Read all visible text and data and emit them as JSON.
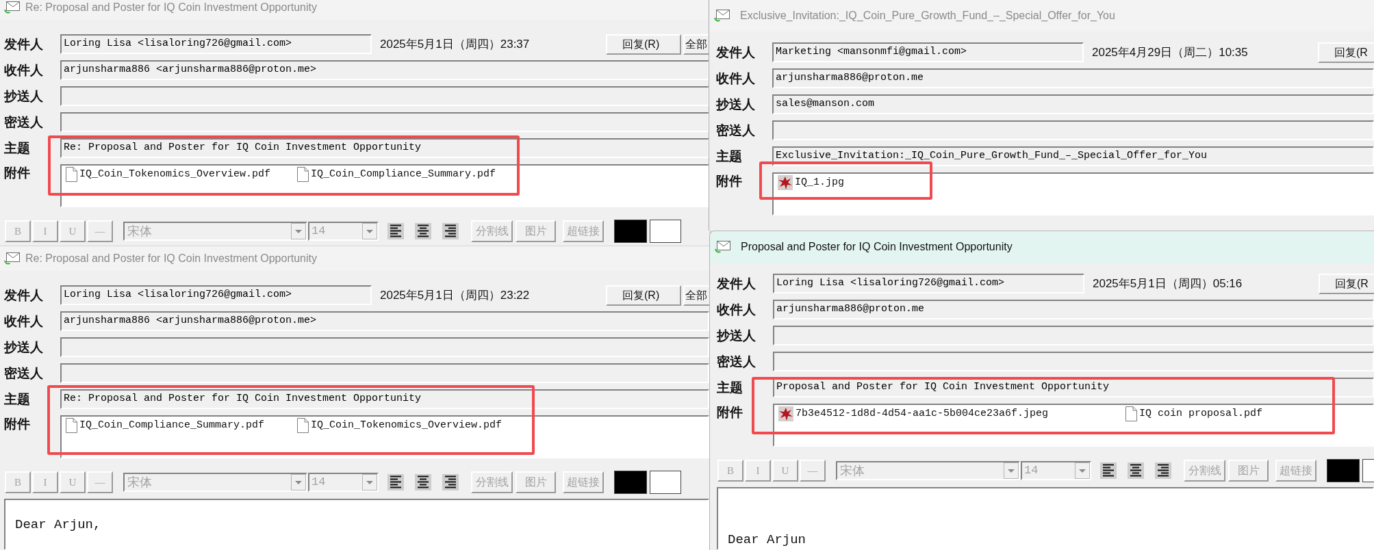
{
  "windows": [
    {
      "title": "Re: Proposal and Poster for IQ Coin Investment Opportunity",
      "active": false,
      "highlighted": true,
      "sender": {
        "label": "发件人",
        "value": "Loring Lisa <lisaloring726@gmail.com>"
      },
      "date": "2025年5月1日（周四）23:37",
      "buttons": [
        "回复(R)",
        "全部"
      ],
      "fields": [
        {
          "label": "收件人",
          "value": "arjunsharma886 <arjunsharma886@proton.me>"
        },
        {
          "label": "抄送人"
        },
        {
          "label": "密送人"
        },
        {
          "label": "主题",
          "value": "Re: Proposal and Poster for IQ Coin Investment Opportunity"
        }
      ],
      "attachments": {
        "label": "附件",
        "files": [
          {
            "kind": "document",
            "name": "IQ_Coin_Tokenomics_Overview.pdf"
          },
          {
            "kind": "document",
            "name": "IQ_Coin_Compliance_Summary.pdf"
          }
        ]
      },
      "toolbar": {
        "disabled": true,
        "format_buttons": [
          "B",
          "I",
          "U",
          "—"
        ],
        "font": "宋体",
        "size": "14",
        "buttons": [
          "分割线",
          "图片",
          "超链接"
        ],
        "swatches": [
          {
            "color": "#000000"
          },
          {
            "color": "#ffffff"
          }
        ]
      }
    },
    {
      "title": "Re: Proposal and Poster for IQ Coin Investment Opportunity",
      "active": false,
      "highlighted": true,
      "sender": {
        "label": "发件人",
        "value": "Loring Lisa <lisaloring726@gmail.com>"
      },
      "date": "2025年5月1日（周四）23:22",
      "buttons": [
        "回复(R)",
        "全部"
      ],
      "fields": [
        {
          "label": "收件人",
          "value": "arjunsharma886 <arjunsharma886@proton.me>"
        },
        {
          "label": "抄送人"
        },
        {
          "label": "密送人"
        },
        {
          "label": "主题",
          "value": "Re: Proposal and Poster for IQ Coin Investment Opportunity"
        }
      ],
      "attachments": {
        "label": "附件",
        "files": [
          {
            "kind": "document",
            "name": "IQ_Coin_Compliance_Summary.pdf"
          },
          {
            "kind": "document",
            "name": "IQ_Coin_Tokenomics_Overview.pdf"
          }
        ]
      },
      "toolbar": {
        "disabled": true,
        "format_buttons": [
          "B",
          "I",
          "U",
          "—"
        ],
        "font": "宋体",
        "size": "14",
        "buttons": [
          "分割线",
          "图片",
          "超链接"
        ],
        "swatches": [
          {
            "color": "#000000"
          },
          {
            "color": "#ffffff"
          }
        ]
      },
      "body": "Dear Arjun,"
    },
    {
      "title": "Exclusive_Invitation:_IQ_Coin_Pure_Growth_Fund_–_Special_Offer_for_You",
      "active": false,
      "highlighted": true,
      "sender": {
        "label": "发件人",
        "value": "Marketing <mansonmfi@gmail.com>"
      },
      "date": "2025年4月29日（周二）10:35",
      "buttons": [
        "回复(R"
      ],
      "fields": [
        {
          "label": "收件人",
          "value": "arjunsharma886@proton.me"
        },
        {
          "label": "抄送人",
          "value": "sales@manson.com"
        },
        {
          "label": "密送人"
        },
        {
          "label": "主题",
          "value": "Exclusive_Invitation:_IQ_Coin_Pure_Growth_Fund_–_Special_Offer_for_You"
        }
      ],
      "attachments": {
        "label": "附件",
        "files": [
          {
            "kind": "image",
            "name": "IQ_1.jpg"
          }
        ]
      }
    },
    {
      "title": "Proposal and Poster for IQ Coin Investment Opportunity",
      "active": true,
      "highlighted": true,
      "sender": {
        "label": "发件人",
        "value": "Loring Lisa <lisaloring726@gmail.com>"
      },
      "date": "2025年5月1日（周四）05:16",
      "buttons": [
        "回复(R"
      ],
      "fields": [
        {
          "label": "收件人",
          "value": "arjunsharma886@proton.me"
        },
        {
          "label": "抄送人"
        },
        {
          "label": "密送人"
        },
        {
          "label": "主题",
          "value": "Proposal and Poster for IQ Coin Investment Opportunity"
        }
      ],
      "attachments": {
        "label": "附件",
        "files": [
          {
            "kind": "image",
            "name": "7b3e4512-1d8d-4d54-aa1c-5b004ce23a6f.jpeg"
          },
          {
            "kind": "document",
            "name": "IQ coin proposal.pdf"
          }
        ]
      },
      "toolbar": {
        "disabled": true,
        "format_buttons": [
          "B",
          "I",
          "U",
          "—"
        ],
        "font": "宋体",
        "size": "14",
        "buttons": [
          "分割线",
          "图片",
          "超链接"
        ],
        "swatches": [
          {
            "color": "#000000"
          },
          {
            "color": "#ffffff"
          }
        ]
      },
      "body": "Dear Arjun"
    }
  ]
}
